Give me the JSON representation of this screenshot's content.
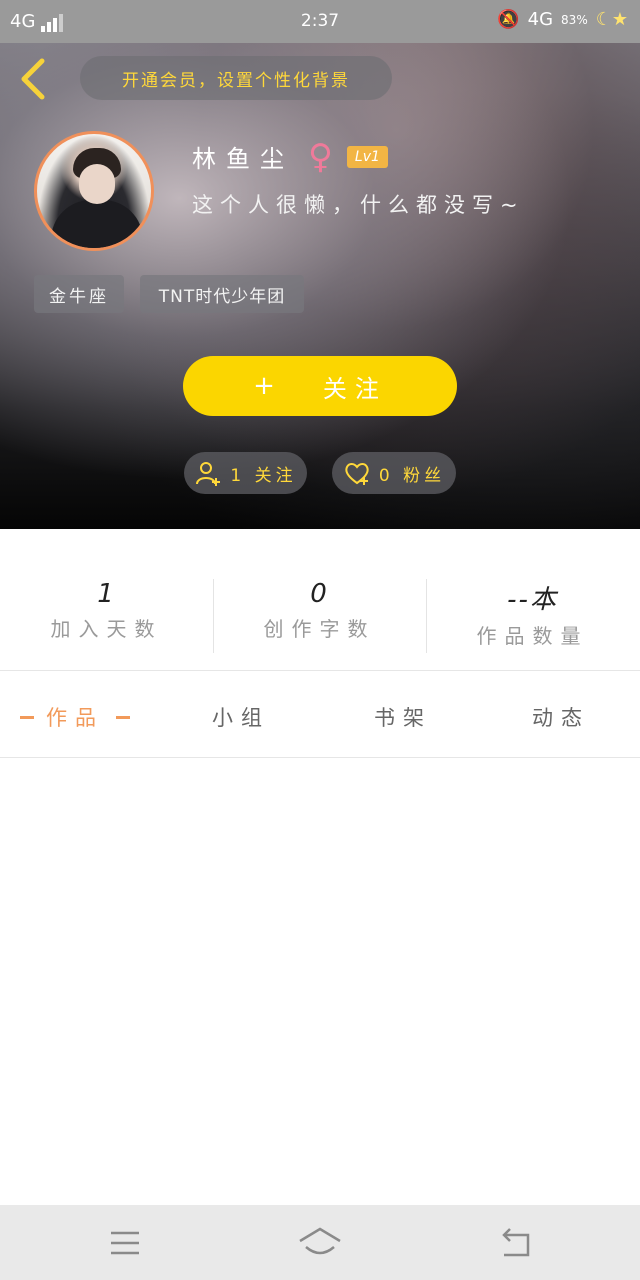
{
  "status_bar": {
    "network_left": "4G",
    "time": "2:37",
    "network_right": "4G",
    "battery": "83%"
  },
  "header": {
    "hint": "开通会员，设置个性化背景",
    "username": "林鱼尘",
    "level": "Lv1",
    "bio": "这个人很懒，什么都没写~",
    "tags": [
      "金牛座",
      "TNT时代少年团"
    ],
    "follow_label": "关注",
    "following_label": "1 关注",
    "fans_label": "0 粉丝"
  },
  "stats": [
    {
      "value": "1",
      "label": "加入天数"
    },
    {
      "value": "0",
      "label": "创作字数"
    },
    {
      "value": "--本",
      "label": "作品数量"
    }
  ],
  "tabs": [
    "作品",
    "小组",
    "书架",
    "动态"
  ],
  "colors": {
    "accent_yellow": "#fbd600",
    "hint_text": "#ffd83a",
    "active_tab": "#f29a5a",
    "avatar_ring": "#f0905a",
    "level_badge": "#f2b544"
  },
  "icons": [
    "back-icon",
    "female-icon",
    "plus-icon",
    "add-user-icon",
    "heart-plus-icon",
    "menu-icon",
    "home-icon",
    "return-icon"
  ]
}
